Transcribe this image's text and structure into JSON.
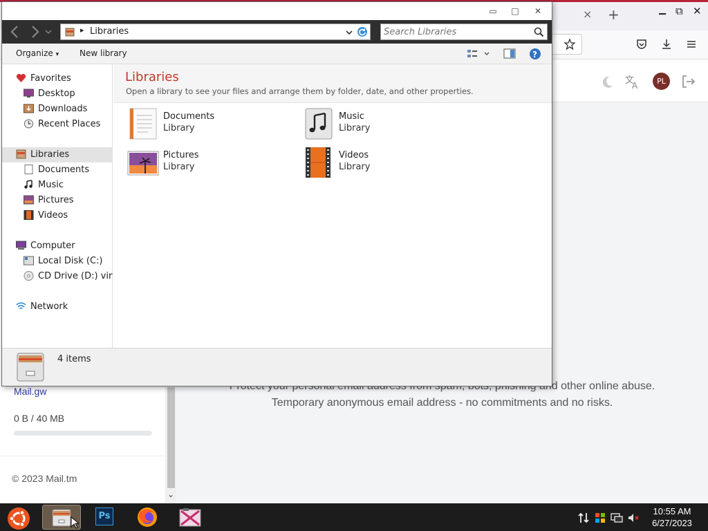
{
  "browser": {
    "tab_close": "×",
    "new_tab": "+",
    "window_minimize": "▁",
    "window_maximize": "⧉",
    "window_close": "✕",
    "icons": [
      "star-icon",
      "pocket-icon",
      "download-icon",
      "menu-icon"
    ]
  },
  "mail": {
    "user_initials": "PL",
    "promo_line1": "Protect your personal email address from spam, bots, phishing and other online abuse.",
    "promo_line2": "Temporary anonymous email address - no commitments and no risks.",
    "site_link": "Mail.gw",
    "storage": "0 B  / 40 MB",
    "storage_fraction": 0,
    "footer": "© 2023 Mail.tm",
    "scroll_arrow": "⌄"
  },
  "explorer": {
    "title_controls": {
      "minimize": "▭",
      "maximize": "□",
      "close": "✕"
    },
    "address_path": "Libraries",
    "search_placeholder": "Search Libraries",
    "organize": "Organize",
    "new_library": "New library",
    "help": "?",
    "header_title": "Libraries",
    "header_sub": "Open a library to see your files and arrange them by folder, date, and other properties.",
    "nav": {
      "favorites": "Favorites",
      "desktop": "Desktop",
      "downloads": "Downloads",
      "recent": "Recent Places",
      "libraries": "Libraries",
      "documents": "Documents",
      "music": "Music",
      "pictures": "Pictures",
      "videos": "Videos",
      "computer": "Computer",
      "local_disk": "Local Disk (C:)",
      "cd_drive": "CD Drive (D:) virtio",
      "network": "Network"
    },
    "libraries": [
      {
        "name": "Documents",
        "type": "Library"
      },
      {
        "name": "Music",
        "type": "Library"
      },
      {
        "name": "Pictures",
        "type": "Library"
      },
      {
        "name": "Videos",
        "type": "Library"
      }
    ],
    "status": "4 items"
  },
  "taskbar": {
    "apps": [
      "start-button",
      "file-explorer-icon",
      "photoshop-icon",
      "firefox-icon",
      "media-app-icon"
    ],
    "ps_label": "Ps",
    "time": "10:55 AM",
    "date": "6/27/2023"
  }
}
